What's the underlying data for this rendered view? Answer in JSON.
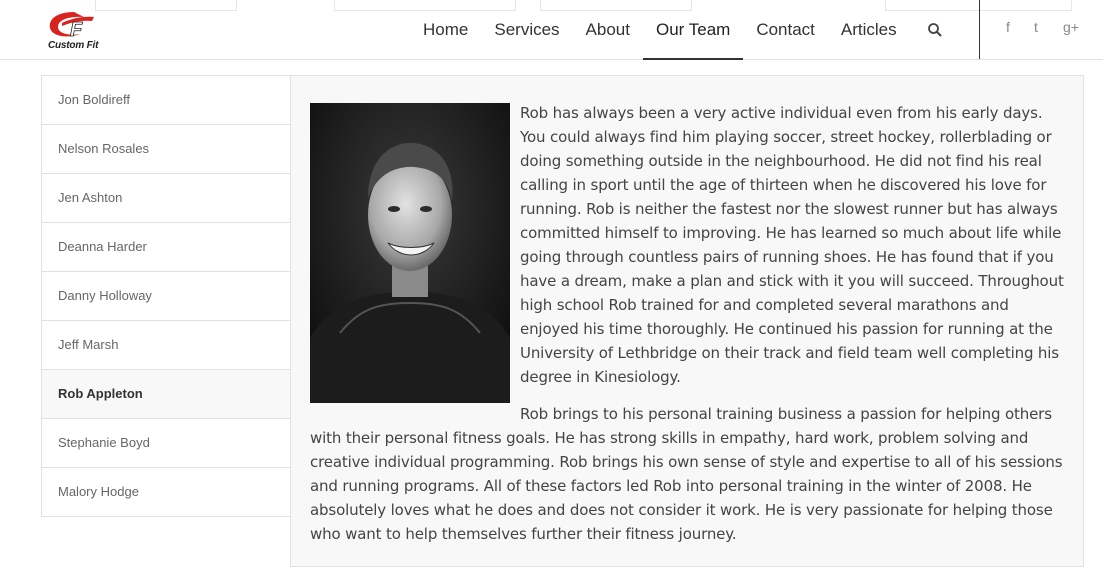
{
  "logo": {
    "text": "Custom Fit"
  },
  "nav": {
    "items": [
      {
        "label": "Home"
      },
      {
        "label": "Services"
      },
      {
        "label": "About"
      },
      {
        "label": "Our Team"
      },
      {
        "label": "Contact"
      },
      {
        "label": "Articles"
      }
    ],
    "active": "Our Team"
  },
  "icons": {
    "search": "search-icon",
    "social": [
      "facebook-icon",
      "twitter-icon",
      "google-plus-icon"
    ]
  },
  "social": {
    "facebook": "f",
    "twitter": "t",
    "googleplus": "g+"
  },
  "sidebar": {
    "items": [
      {
        "label": "Jon Boldireff"
      },
      {
        "label": "Nelson Rosales"
      },
      {
        "label": "Jen Ashton"
      },
      {
        "label": "Deanna Harder"
      },
      {
        "label": "Danny Holloway"
      },
      {
        "label": "Jeff Marsh"
      },
      {
        "label": "Rob Appleton"
      },
      {
        "label": "Stephanie Boyd"
      },
      {
        "label": "Malory Hodge"
      }
    ],
    "active": "Rob Appleton"
  },
  "content": {
    "paragraph1": "Rob has always been a very active individual even from his early days.  You could always find him playing soccer, street hockey, rollerblading or doing something outside in the neighbourhood.  He did not find his real calling in sport until the age of thirteen when he discovered his love for running.  Rob is neither the fastest nor the slowest runner but has always committed himself to improving.  He has learned so much about life while going through countless pairs of running shoes.  He has found that if you have a dream, make a plan and stick with it you will succeed.  Throughout high school Rob trained for and completed several marathons and enjoyed his time thoroughly.  He continued his passion for running at the University of Lethbridge on their track and field team well completing his degree in Kinesiology.",
    "paragraph2": "Rob brings to his personal training business a passion for helping others with their personal fitness goals.  He has strong skills in empathy, hard work, problem solving and creative individual programming.  Rob brings his own sense of style and expertise to all of his sessions and running programs.  All of these factors led Rob into personal training in the winter of 2008.  He absolutely loves what he does and does not consider it work.  He is very passionate for helping those who want to help themselves further their fitness journey."
  },
  "colors": {
    "logo_red": "#d9231e",
    "active_bg": "#f8f8f8",
    "content_bg": "#f8f8f8",
    "border": "#e1e1e1"
  }
}
